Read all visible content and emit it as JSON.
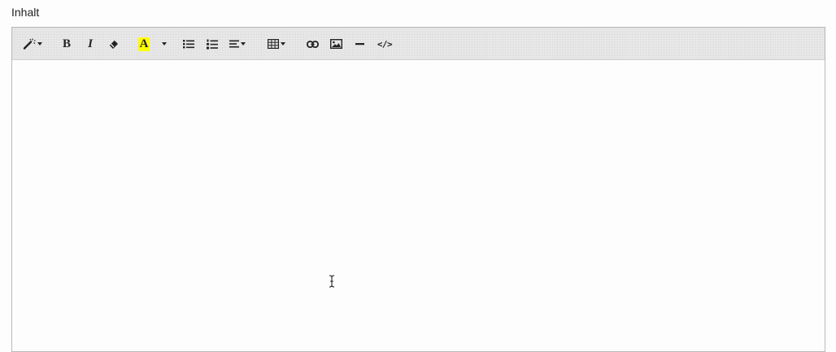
{
  "field": {
    "label": "Inhalt"
  },
  "toolbar": {
    "buttons": [
      {
        "name": "style-button",
        "icon": "magic-wand-icon",
        "dropdown": true
      },
      {
        "name": "bold-button",
        "icon": "bold-icon",
        "glyph": "B"
      },
      {
        "name": "italic-button",
        "icon": "italic-icon",
        "glyph": "I"
      },
      {
        "name": "clear-format-button",
        "icon": "eraser-icon"
      },
      {
        "name": "color-button",
        "icon": "text-color-icon",
        "glyph": "A",
        "highlight": "#ffff00"
      },
      {
        "name": "color-dropdown-button",
        "icon": "caret-down-icon"
      },
      {
        "name": "unordered-list-button",
        "icon": "bullet-list-icon"
      },
      {
        "name": "ordered-list-button",
        "icon": "numbered-list-icon"
      },
      {
        "name": "paragraph-align-button",
        "icon": "align-left-icon",
        "dropdown": true
      },
      {
        "name": "table-button",
        "icon": "table-icon",
        "dropdown": true
      },
      {
        "name": "link-button",
        "icon": "link-icon"
      },
      {
        "name": "picture-button",
        "icon": "image-icon"
      },
      {
        "name": "horizontal-rule-button",
        "icon": "minus-icon"
      },
      {
        "name": "code-view-button",
        "icon": "code-icon"
      }
    ],
    "bold_glyph": "B",
    "italic_glyph": "I",
    "color_glyph": "A",
    "code_glyph": "</>"
  },
  "editor": {
    "content": ""
  },
  "colors": {
    "highlight": "#ffff00",
    "toolbar_bg": "#eeeeee",
    "border": "#b9b9b9"
  }
}
